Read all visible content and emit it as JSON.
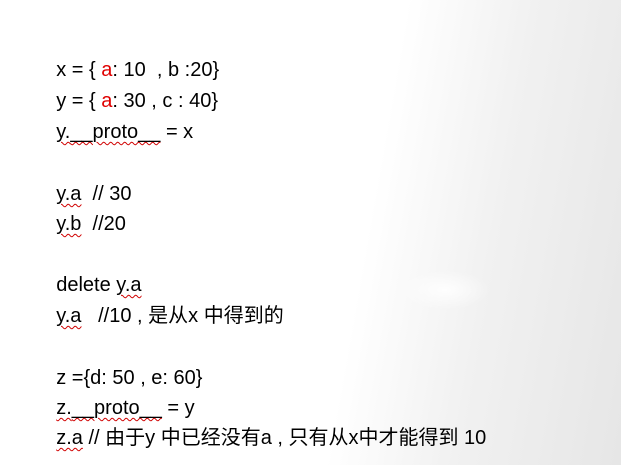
{
  "lines": {
    "l1": {
      "a": "x = { ",
      "b": "a",
      "c": ": 10  , b :20}"
    },
    "l2": {
      "a": "y = { ",
      "b": "a",
      "c": ": 30 , c : 40}"
    },
    "l3": {
      "a": "y.",
      "b": "__proto__",
      "c": " = x"
    },
    "l4": {
      "a": "y.a",
      "b": "  // 30"
    },
    "l5": {
      "a": "y.b",
      "b": "  //20"
    },
    "l6": {
      "a": "delete ",
      "b": "y.a"
    },
    "l7": {
      "a": "y.a",
      "b": "   //10 , 是从x 中得到的"
    },
    "l8": {
      "a": "z ={d: 50 , e: 60}"
    },
    "l9": {
      "a": "z.",
      "b": "__proto__",
      "c": " = y"
    },
    "l10": {
      "a": "z.a",
      "b": " // 由于y 中已经没有a , 只有从x中才能得到 10"
    }
  },
  "colors": {
    "highlight": "#e00000",
    "spellcheck_underline": "#d00000"
  }
}
